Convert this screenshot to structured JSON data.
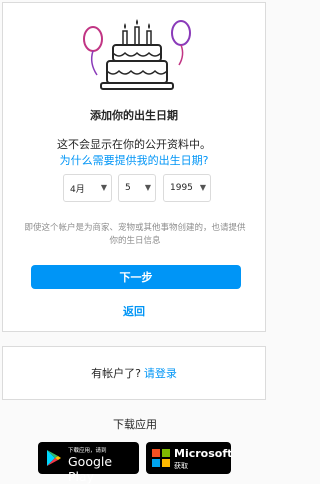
{
  "birthday": {
    "title": "添加你的出生日期",
    "subtitle": "这不会显示在你的公开资料中。",
    "why_link": "为什么需要提供我的出生日期?",
    "month": "4月",
    "day": "5",
    "year": "1995",
    "note": "即使这个帐户是为商家、宠物或其他事物创建的，也请提供你的生日信息",
    "next_label": "下一步",
    "back_label": "返回"
  },
  "login_card": {
    "prompt": "有帐户了?",
    "login_link": "请登录"
  },
  "download": {
    "label": "下载应用",
    "google_play_small": "下载应用，请到",
    "google_play_big": "Google Play",
    "microsoft_big": "Microsoft",
    "microsoft_small": "获取"
  },
  "colors": {
    "accent": "#0095f6",
    "balloon_left": "#c13584",
    "balloon_right": "#8a3ab9"
  }
}
